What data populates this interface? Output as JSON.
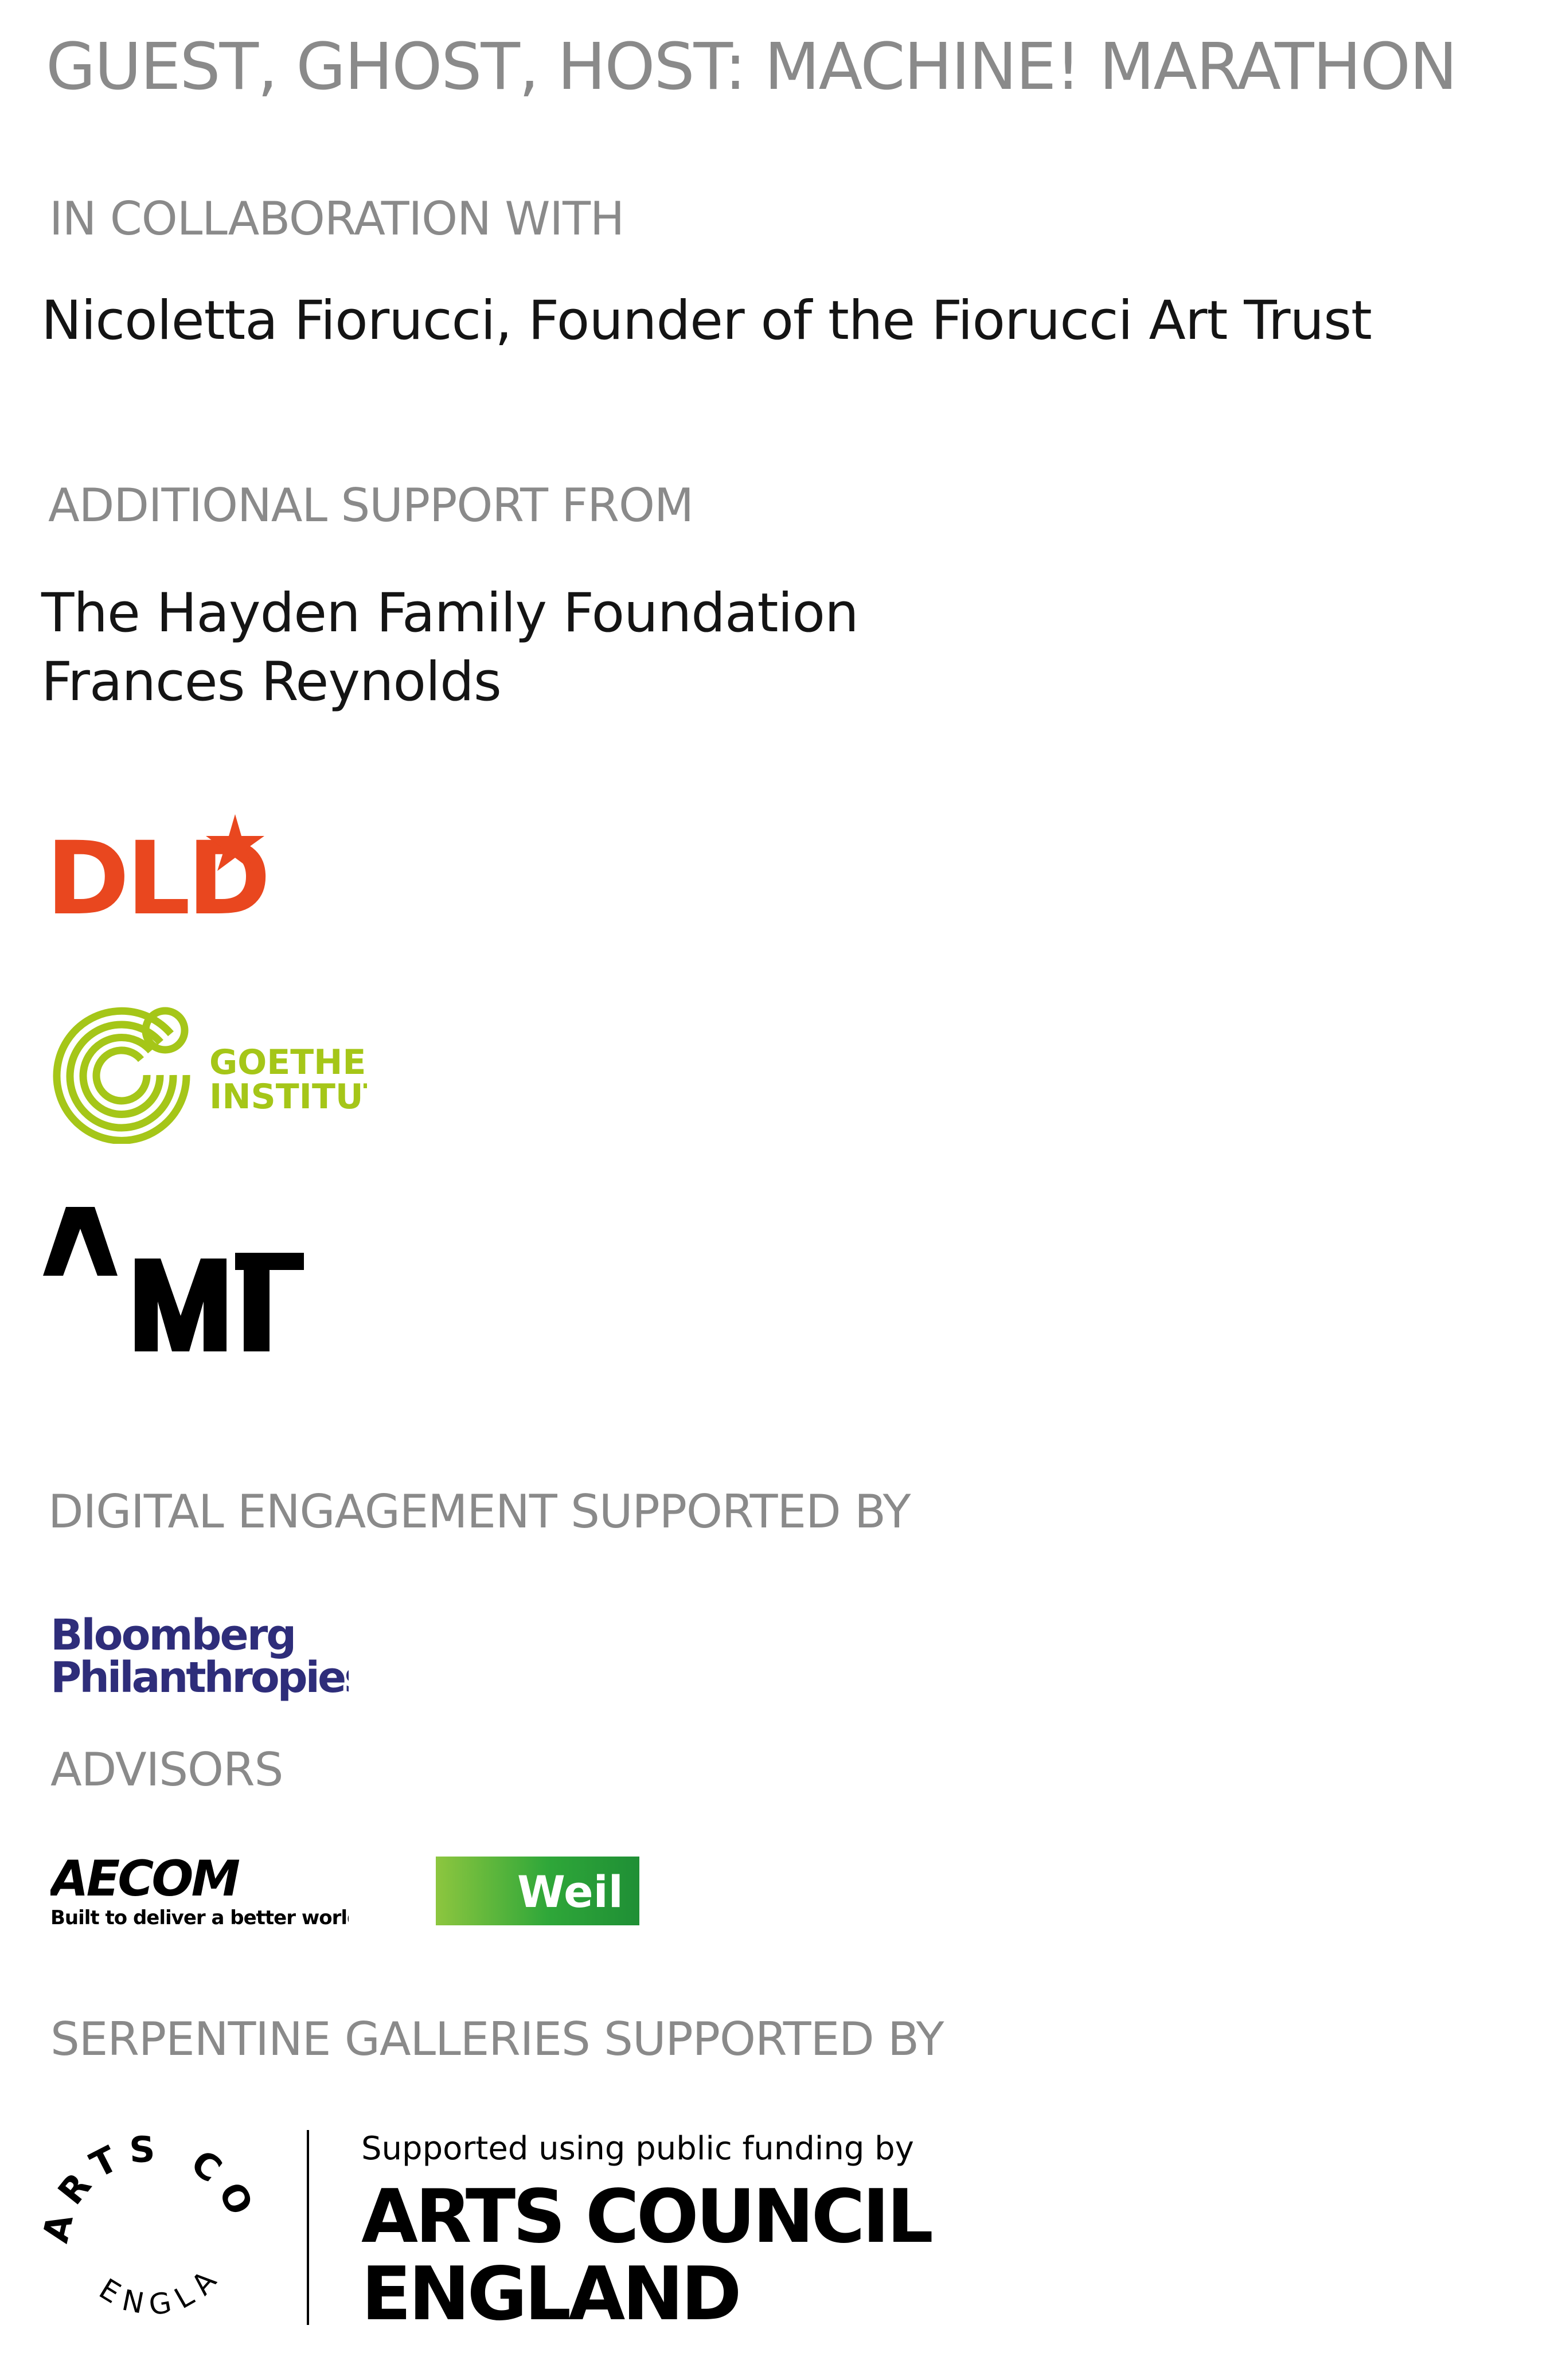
{
  "title": "GUEST, GHOST, HOST: MACHINE! MARATHON",
  "collaboration": {
    "heading": "IN COLLABORATION WITH",
    "name": "Nicoletta Fiorucci, Founder of the Fiorucci Art Trust"
  },
  "additional_support": {
    "heading": "ADDITIONAL SUPPORT FROM",
    "names": [
      "The Hayden Family Foundation",
      "Frances Reynolds"
    ]
  },
  "logos": {
    "dld": {
      "text": "DLD",
      "color": "#e9471f"
    },
    "goethe": {
      "line1": "GOETHE",
      "line2": "INSTITUT",
      "color": "#a5c618"
    },
    "ami": {
      "name": "ami-logo",
      "color": "#000000"
    }
  },
  "digital_engagement": {
    "heading": "DIGITAL ENGAGEMENT SUPPORTED BY",
    "logo": {
      "line1": "Bloomberg",
      "line2": "Philanthropies",
      "color": "#2e2d7a"
    }
  },
  "advisors": {
    "heading": "ADVISORS",
    "aecom": {
      "text": "AECOM",
      "tagline": "Built to deliver a better world"
    },
    "weil": {
      "text": "Weil",
      "color": "#2fa739"
    }
  },
  "serpentine": {
    "heading": "SERPENTINE GALLERIES SUPPORTED BY",
    "arts_council": {
      "ring_top": "ARTS COUNCIL",
      "ring_bottom": "ENGLAND",
      "supported_text": "Supported using public funding by",
      "line1": "ARTS COUNCIL",
      "line2": "ENGLAND"
    }
  }
}
